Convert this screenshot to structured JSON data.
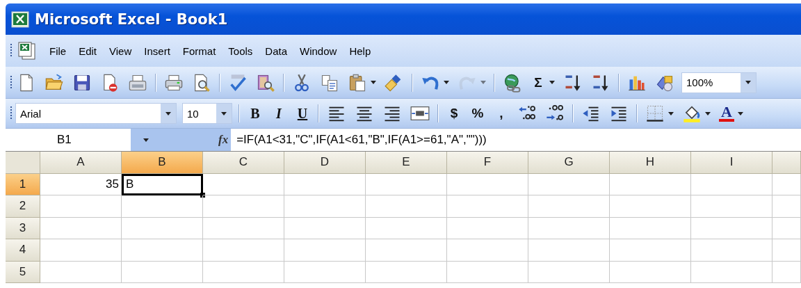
{
  "window": {
    "title": "Microsoft Excel - Book1"
  },
  "menu": [
    {
      "label": "File"
    },
    {
      "label": "Edit"
    },
    {
      "label": "View"
    },
    {
      "label": "Insert"
    },
    {
      "label": "Format"
    },
    {
      "label": "Tools"
    },
    {
      "label": "Data"
    },
    {
      "label": "Window"
    },
    {
      "label": "Help"
    }
  ],
  "standard_toolbar": [
    {
      "kind": "button",
      "disabled": false,
      "dropdown": false
    },
    {
      "kind": "button",
      "disabled": false,
      "dropdown": false
    },
    {
      "kind": "button",
      "disabled": false,
      "dropdown": false
    },
    {
      "kind": "button",
      "disabled": false,
      "dropdown": false
    },
    {
      "kind": "button",
      "disabled": false,
      "dropdown": false
    },
    {
      "kind": "separator"
    },
    {
      "kind": "button",
      "disabled": false,
      "dropdown": false
    },
    {
      "kind": "button",
      "disabled": false,
      "dropdown": false
    },
    {
      "kind": "separator"
    },
    {
      "kind": "button",
      "disabled": false,
      "dropdown": false
    },
    {
      "kind": "button",
      "disabled": false,
      "dropdown": false
    },
    {
      "kind": "separator"
    },
    {
      "kind": "button",
      "disabled": false,
      "dropdown": false
    },
    {
      "kind": "button",
      "disabled": false,
      "dropdown": false
    },
    {
      "kind": "button",
      "disabled": false,
      "dropdown": true
    },
    {
      "kind": "button",
      "disabled": false,
      "dropdown": false
    },
    {
      "kind": "separator"
    },
    {
      "kind": "button",
      "disabled": false,
      "dropdown": true
    },
    {
      "kind": "button",
      "disabled": true,
      "dropdown": true
    },
    {
      "kind": "separator"
    },
    {
      "kind": "button",
      "disabled": false,
      "dropdown": false
    },
    {
      "kind": "glyph",
      "label": "Σ",
      "disabled": false,
      "dropdown": true
    },
    {
      "kind": "button",
      "disabled": false,
      "dropdown": false
    },
    {
      "kind": "button",
      "disabled": false,
      "dropdown": false
    },
    {
      "kind": "separator"
    },
    {
      "kind": "button",
      "disabled": false,
      "dropdown": false
    },
    {
      "kind": "button",
      "disabled": false,
      "dropdown": false
    },
    {
      "kind": "combo",
      "value": "100%"
    }
  ],
  "formatting_toolbar": [
    {
      "kind": "combo",
      "value": "Arial"
    },
    {
      "kind": "combo",
      "value": "10"
    },
    {
      "kind": "separator"
    },
    {
      "kind": "glyph",
      "label": "B",
      "disabled": false,
      "dropdown": false
    },
    {
      "kind": "glyph",
      "label": "I",
      "disabled": false,
      "dropdown": false
    },
    {
      "kind": "glyph",
      "label": "U",
      "disabled": false,
      "dropdown": false
    },
    {
      "kind": "separator"
    },
    {
      "kind": "button",
      "disabled": false,
      "dropdown": false
    },
    {
      "kind": "button",
      "disabled": false,
      "dropdown": false
    },
    {
      "kind": "button",
      "disabled": false,
      "dropdown": false
    },
    {
      "kind": "button",
      "disabled": false,
      "dropdown": false
    },
    {
      "kind": "separator"
    },
    {
      "kind": "glyph",
      "label": "$",
      "disabled": false,
      "dropdown": false
    },
    {
      "kind": "glyph",
      "label": "%",
      "disabled": false,
      "dropdown": false
    },
    {
      "kind": "glyph",
      "label": ",",
      "disabled": false,
      "dropdown": false
    },
    {
      "kind": "button",
      "disabled": false,
      "dropdown": false
    },
    {
      "kind": "button",
      "disabled": false,
      "dropdown": false
    },
    {
      "kind": "separator"
    },
    {
      "kind": "button",
      "disabled": false,
      "dropdown": false
    },
    {
      "kind": "button",
      "disabled": false,
      "dropdown": false
    },
    {
      "kind": "separator"
    },
    {
      "kind": "button",
      "disabled": false,
      "dropdown": true
    },
    {
      "kind": "button",
      "disabled": false,
      "dropdown": true
    },
    {
      "kind": "glyph",
      "label": "A",
      "disabled": false,
      "dropdown": true
    }
  ],
  "formula_bar": {
    "name_box": "B1",
    "function_button": "fx",
    "formula": "=IF(A1<31,\"C\",IF(A1<61,\"B\",IF(A1>=61,\"A\",\"\")))"
  },
  "sheet": {
    "columns": [
      {
        "label": "A",
        "selected": false
      },
      {
        "label": "B",
        "selected": true
      },
      {
        "label": "C",
        "selected": false
      },
      {
        "label": "D",
        "selected": false
      },
      {
        "label": "E",
        "selected": false
      },
      {
        "label": "F",
        "selected": false
      },
      {
        "label": "G",
        "selected": false
      },
      {
        "label": "H",
        "selected": false
      },
      {
        "label": "I",
        "selected": false
      }
    ],
    "rows": [
      {
        "header": "1",
        "selected": true,
        "cells": [
          {
            "value": "35",
            "right_aligned": true,
            "active": false
          },
          {
            "value": "B",
            "right_aligned": false,
            "active": true
          }
        ]
      },
      {
        "header": "2",
        "selected": false
      },
      {
        "header": "3",
        "selected": false
      },
      {
        "header": "4",
        "selected": false
      },
      {
        "header": "5",
        "selected": false
      }
    ]
  }
}
